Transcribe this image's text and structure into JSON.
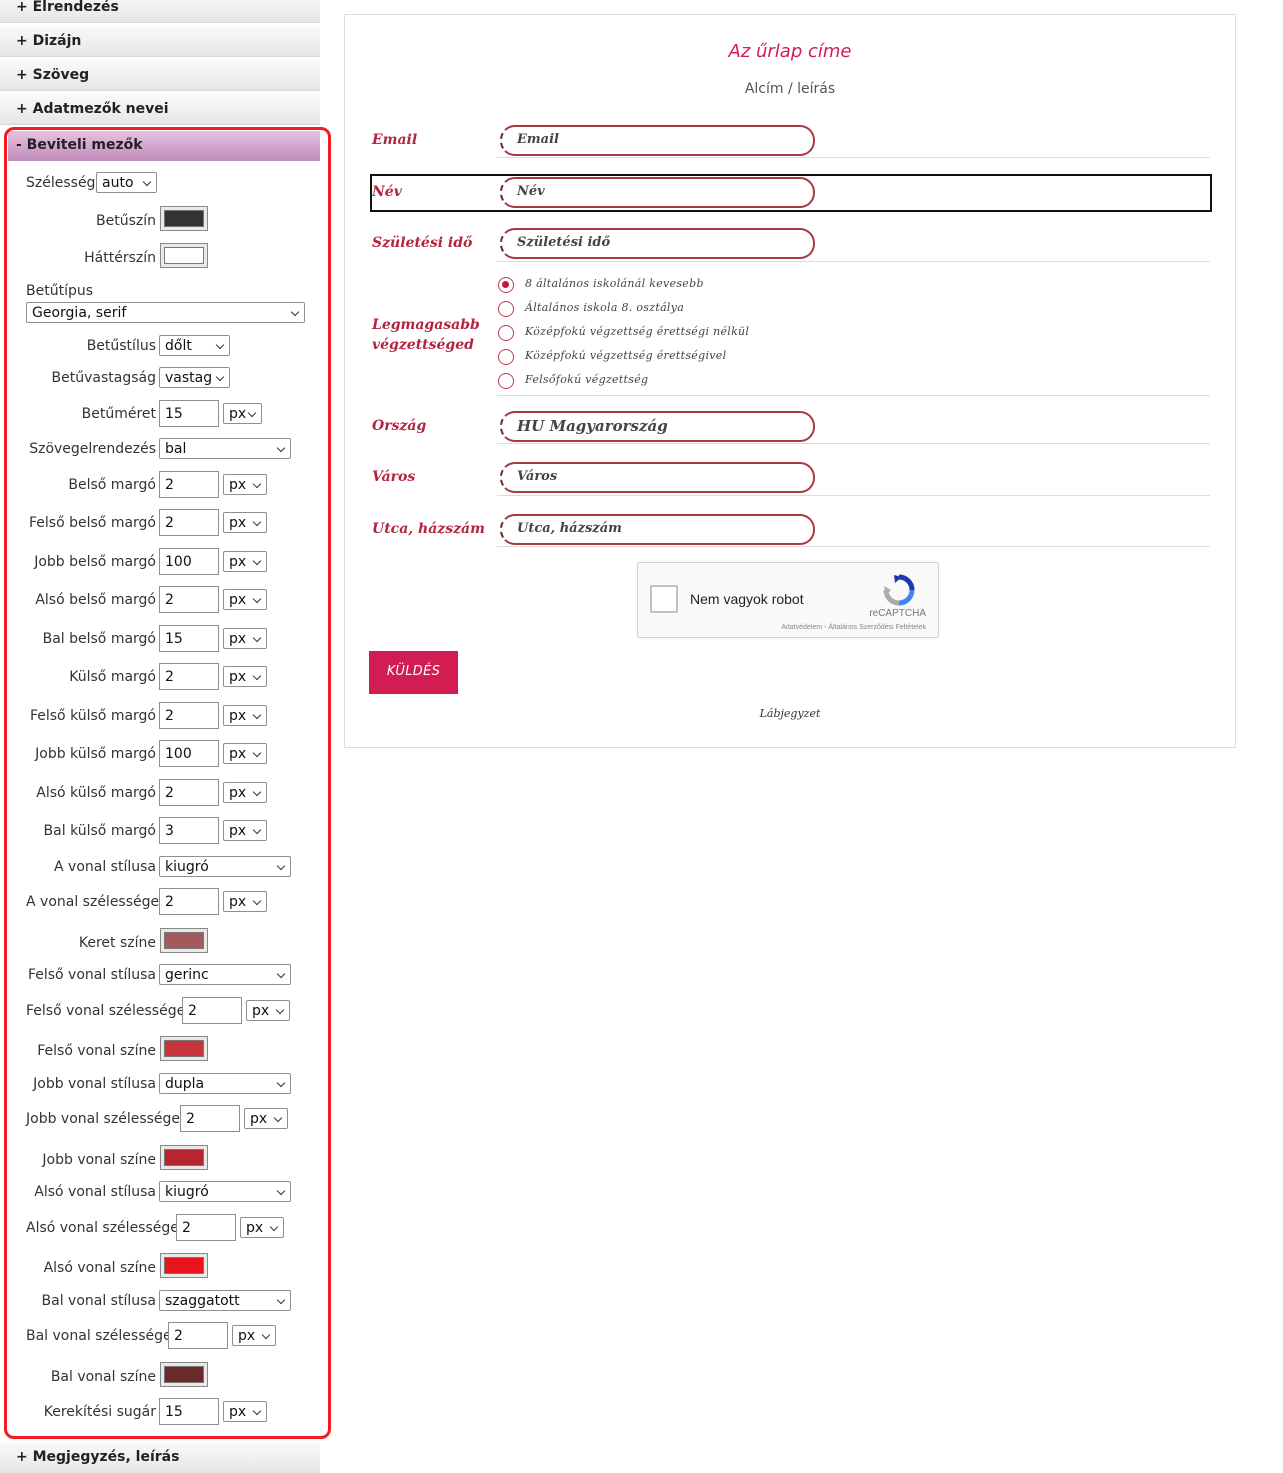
{
  "sidebar": {
    "sections": {
      "elrendezes": "+ Elrendezés",
      "dizajn": "+ Dizájn",
      "szoveg": "+ Szöveg",
      "adatmezok": "+ Adatmezők nevei",
      "beviteli": "- Beviteli mezők",
      "megjegyzes": "+ Megjegyzés, leírás"
    },
    "fields": {
      "szelesseg": {
        "label": "Szélesség",
        "value": "auto"
      },
      "betuszin": {
        "label": "Betűszín",
        "color": "#333333"
      },
      "hatterszin": {
        "label": "Háttérszín",
        "color": "#ffffff"
      },
      "betutipus": {
        "label": "Betűtípus",
        "value": "Georgia, serif"
      },
      "betustilus": {
        "label": "Betűstílus",
        "value": "dőlt"
      },
      "betuvastagsag": {
        "label": "Betűvastagság",
        "value": "vastag"
      },
      "betumeret": {
        "label": "Betűméret",
        "value": "15",
        "unit": "px"
      },
      "szovegelrendezes": {
        "label": "Szövegelrendezés",
        "value": "bal"
      },
      "belso_margo": {
        "label": "Belső margó",
        "value": "2",
        "unit": "px"
      },
      "felso_belso_margo": {
        "label": "Felső belső margó",
        "value": "2",
        "unit": "px"
      },
      "jobb_belso_margo": {
        "label": "Jobb belső margó",
        "value": "100",
        "unit": "px"
      },
      "also_belso_margo": {
        "label": "Alsó belső margó",
        "value": "2",
        "unit": "px"
      },
      "bal_belso_margo": {
        "label": "Bal belső margó",
        "value": "15",
        "unit": "px"
      },
      "kulso_margo": {
        "label": "Külső margó",
        "value": "2",
        "unit": "px"
      },
      "felso_kulso_margo": {
        "label": "Felső külső margó",
        "value": "2",
        "unit": "px"
      },
      "jobb_kulso_margo": {
        "label": "Jobb külső margó",
        "value": "100",
        "unit": "px"
      },
      "also_kulso_margo": {
        "label": "Alsó külső margó",
        "value": "2",
        "unit": "px"
      },
      "bal_kulso_margo": {
        "label": "Bal külső margó",
        "value": "3",
        "unit": "px"
      },
      "vonal_stilusa": {
        "label": "A vonal stílusa",
        "value": "kiugró"
      },
      "vonal_szelessege": {
        "label": "A vonal szélessége",
        "value": "2",
        "unit": "px"
      },
      "keret_szine": {
        "label": "Keret színe",
        "color": "#a35a5e"
      },
      "felso_vonal_stilusa": {
        "label": "Felső vonal stílusa",
        "value": "gerinc"
      },
      "felso_vonal_szelessege": {
        "label": "Felső vonal szélessége",
        "value": "2",
        "unit": "px"
      },
      "felso_vonal_szine": {
        "label": "Felső vonal színe",
        "color": "#c8353d"
      },
      "jobb_vonal_stilusa": {
        "label": "Jobb vonal stílusa",
        "value": "dupla"
      },
      "jobb_vonal_szelessege": {
        "label": "Jobb vonal szélessége",
        "value": "2",
        "unit": "px"
      },
      "jobb_vonal_szine": {
        "label": "Jobb vonal színe",
        "color": "#b5262f"
      },
      "also_vonal_stilusa": {
        "label": "Alsó vonal stílusa",
        "value": "kiugró"
      },
      "also_vonal_szelessege": {
        "label": "Alsó vonal szélessége",
        "value": "2",
        "unit": "px"
      },
      "also_vonal_szine": {
        "label": "Alsó vonal színe",
        "color": "#e8161c"
      },
      "bal_vonal_stilusa": {
        "label": "Bal vonal stílusa",
        "value": "szaggatott"
      },
      "bal_vonal_szelessege": {
        "label": "Bal vonal szélessége",
        "value": "2",
        "unit": "px"
      },
      "bal_vonal_szine": {
        "label": "Bal vonal színe",
        "color": "#6b2a2a"
      },
      "kerekitesi_sugar": {
        "label": "Kerekítési sugár",
        "value": "15",
        "unit": "px"
      }
    }
  },
  "form": {
    "title": "Az űrlap címe",
    "subtitle": "Alcím / leírás",
    "fields": {
      "email": {
        "label": "Email",
        "placeholder": "Email"
      },
      "nev": {
        "label": "Név",
        "placeholder": "Név"
      },
      "szuletesi": {
        "label": "Születési idő",
        "placeholder": "Születési idő"
      },
      "vegzettseg_line1": "Legmagasabb",
      "vegzettseg_line2": "végzettséged",
      "orszag": {
        "label": "Ország",
        "value": "HU Magyarország"
      },
      "varos": {
        "label": "Város",
        "placeholder": "Város"
      },
      "utca": {
        "label": "Utca, házszám",
        "placeholder": "Utca, házszám"
      }
    },
    "education_options": [
      "8 általános iskolánál kevesebb",
      "Általános iskola 8. osztálya",
      "Középfokú végzettség érettségi nélkül",
      "Középfokú végzettség érettségivel",
      "Felsőfokú végzettség"
    ],
    "education_selected_index": 0,
    "captcha": {
      "text": "Nem vagyok robot",
      "brand": "reCAPTCHA",
      "links": "Adatvédelem - Általános Szerződési Feltételek"
    },
    "submit": "KÜLDÉS",
    "footnote": "Lábjegyzet"
  },
  "colors": {
    "accent": "#d11d52",
    "label": "#b3243f",
    "highlight": "#ef1c24"
  }
}
